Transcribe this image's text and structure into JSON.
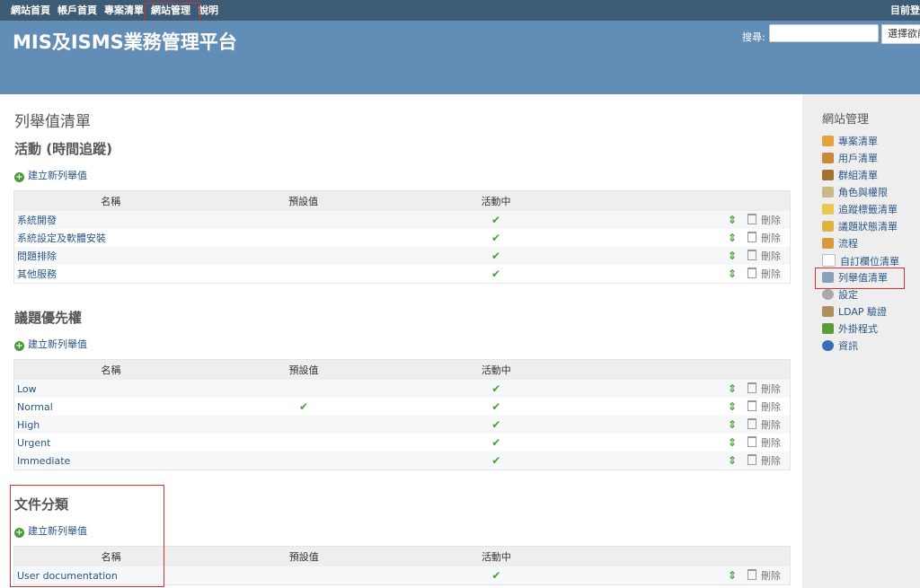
{
  "top_menu": {
    "items": [
      "網站首頁",
      "帳戶首頁",
      "專案清單",
      "網站管理",
      "說明"
    ],
    "login": "目前登"
  },
  "header": {
    "title": "MIS及ISMS業務管理平台",
    "search_label": "搜尋:",
    "search_value": "",
    "project_select": "選擇欲前"
  },
  "page": {
    "title": "列舉值清單"
  },
  "columns": {
    "name": "名稱",
    "default": "預設值",
    "active": "活動中"
  },
  "new_label": "建立新列舉值",
  "delete_label": "刪除",
  "sections": [
    {
      "title": "活動 (時間追蹤)",
      "rows": [
        {
          "name": "系統開發",
          "default": false,
          "active": true
        },
        {
          "name": "系統設定及軟體安裝",
          "default": false,
          "active": true
        },
        {
          "name": "問題排除",
          "default": false,
          "active": true
        },
        {
          "name": "其他服務",
          "default": false,
          "active": true
        }
      ]
    },
    {
      "title": "議題優先權",
      "rows": [
        {
          "name": "Low",
          "default": false,
          "active": true
        },
        {
          "name": "Normal",
          "default": true,
          "active": true
        },
        {
          "name": "High",
          "default": false,
          "active": true
        },
        {
          "name": "Urgent",
          "default": false,
          "active": true
        },
        {
          "name": "Immediate",
          "default": false,
          "active": true
        }
      ]
    },
    {
      "title": "文件分類",
      "rows": [
        {
          "name": "User documentation",
          "default": false,
          "active": true
        }
      ]
    }
  ],
  "sidebar": {
    "title": "網站管理",
    "items": [
      {
        "label": "專案清單",
        "icon": "projects-icon",
        "color": "#e6a23c"
      },
      {
        "label": "用戶清單",
        "icon": "user-icon",
        "color": "#c58a3a"
      },
      {
        "label": "群組清單",
        "icon": "group-icon",
        "color": "#a0732e"
      },
      {
        "label": "角色與權限",
        "icon": "role-icon",
        "color": "#c9b98a"
      },
      {
        "label": "追蹤標籤清單",
        "icon": "tracker-icon",
        "color": "#e8c850"
      },
      {
        "label": "議題狀態清單",
        "icon": "status-icon",
        "color": "#e0b040"
      },
      {
        "label": "流程",
        "icon": "workflow-icon",
        "color": "#d89a3a"
      },
      {
        "label": "自訂欄位清單",
        "icon": "custom-field-icon",
        "color": "#ffffff"
      },
      {
        "label": "列舉值清單",
        "icon": "enumeration-icon",
        "color": "#8aa0b8"
      },
      {
        "label": "設定",
        "icon": "settings-icon",
        "color": "#aaaaaa"
      },
      {
        "label": "LDAP 驗證",
        "icon": "ldap-icon",
        "color": "#b09060"
      },
      {
        "label": "外掛程式",
        "icon": "plugin-icon",
        "color": "#5a9b3a"
      },
      {
        "label": "資訊",
        "icon": "info-icon",
        "color": "#3b6fb5"
      }
    ]
  },
  "colors": {
    "top_bar": "#3e5b76",
    "header": "#628db6",
    "link": "#2a5685",
    "highlight_box": "#d93030"
  }
}
